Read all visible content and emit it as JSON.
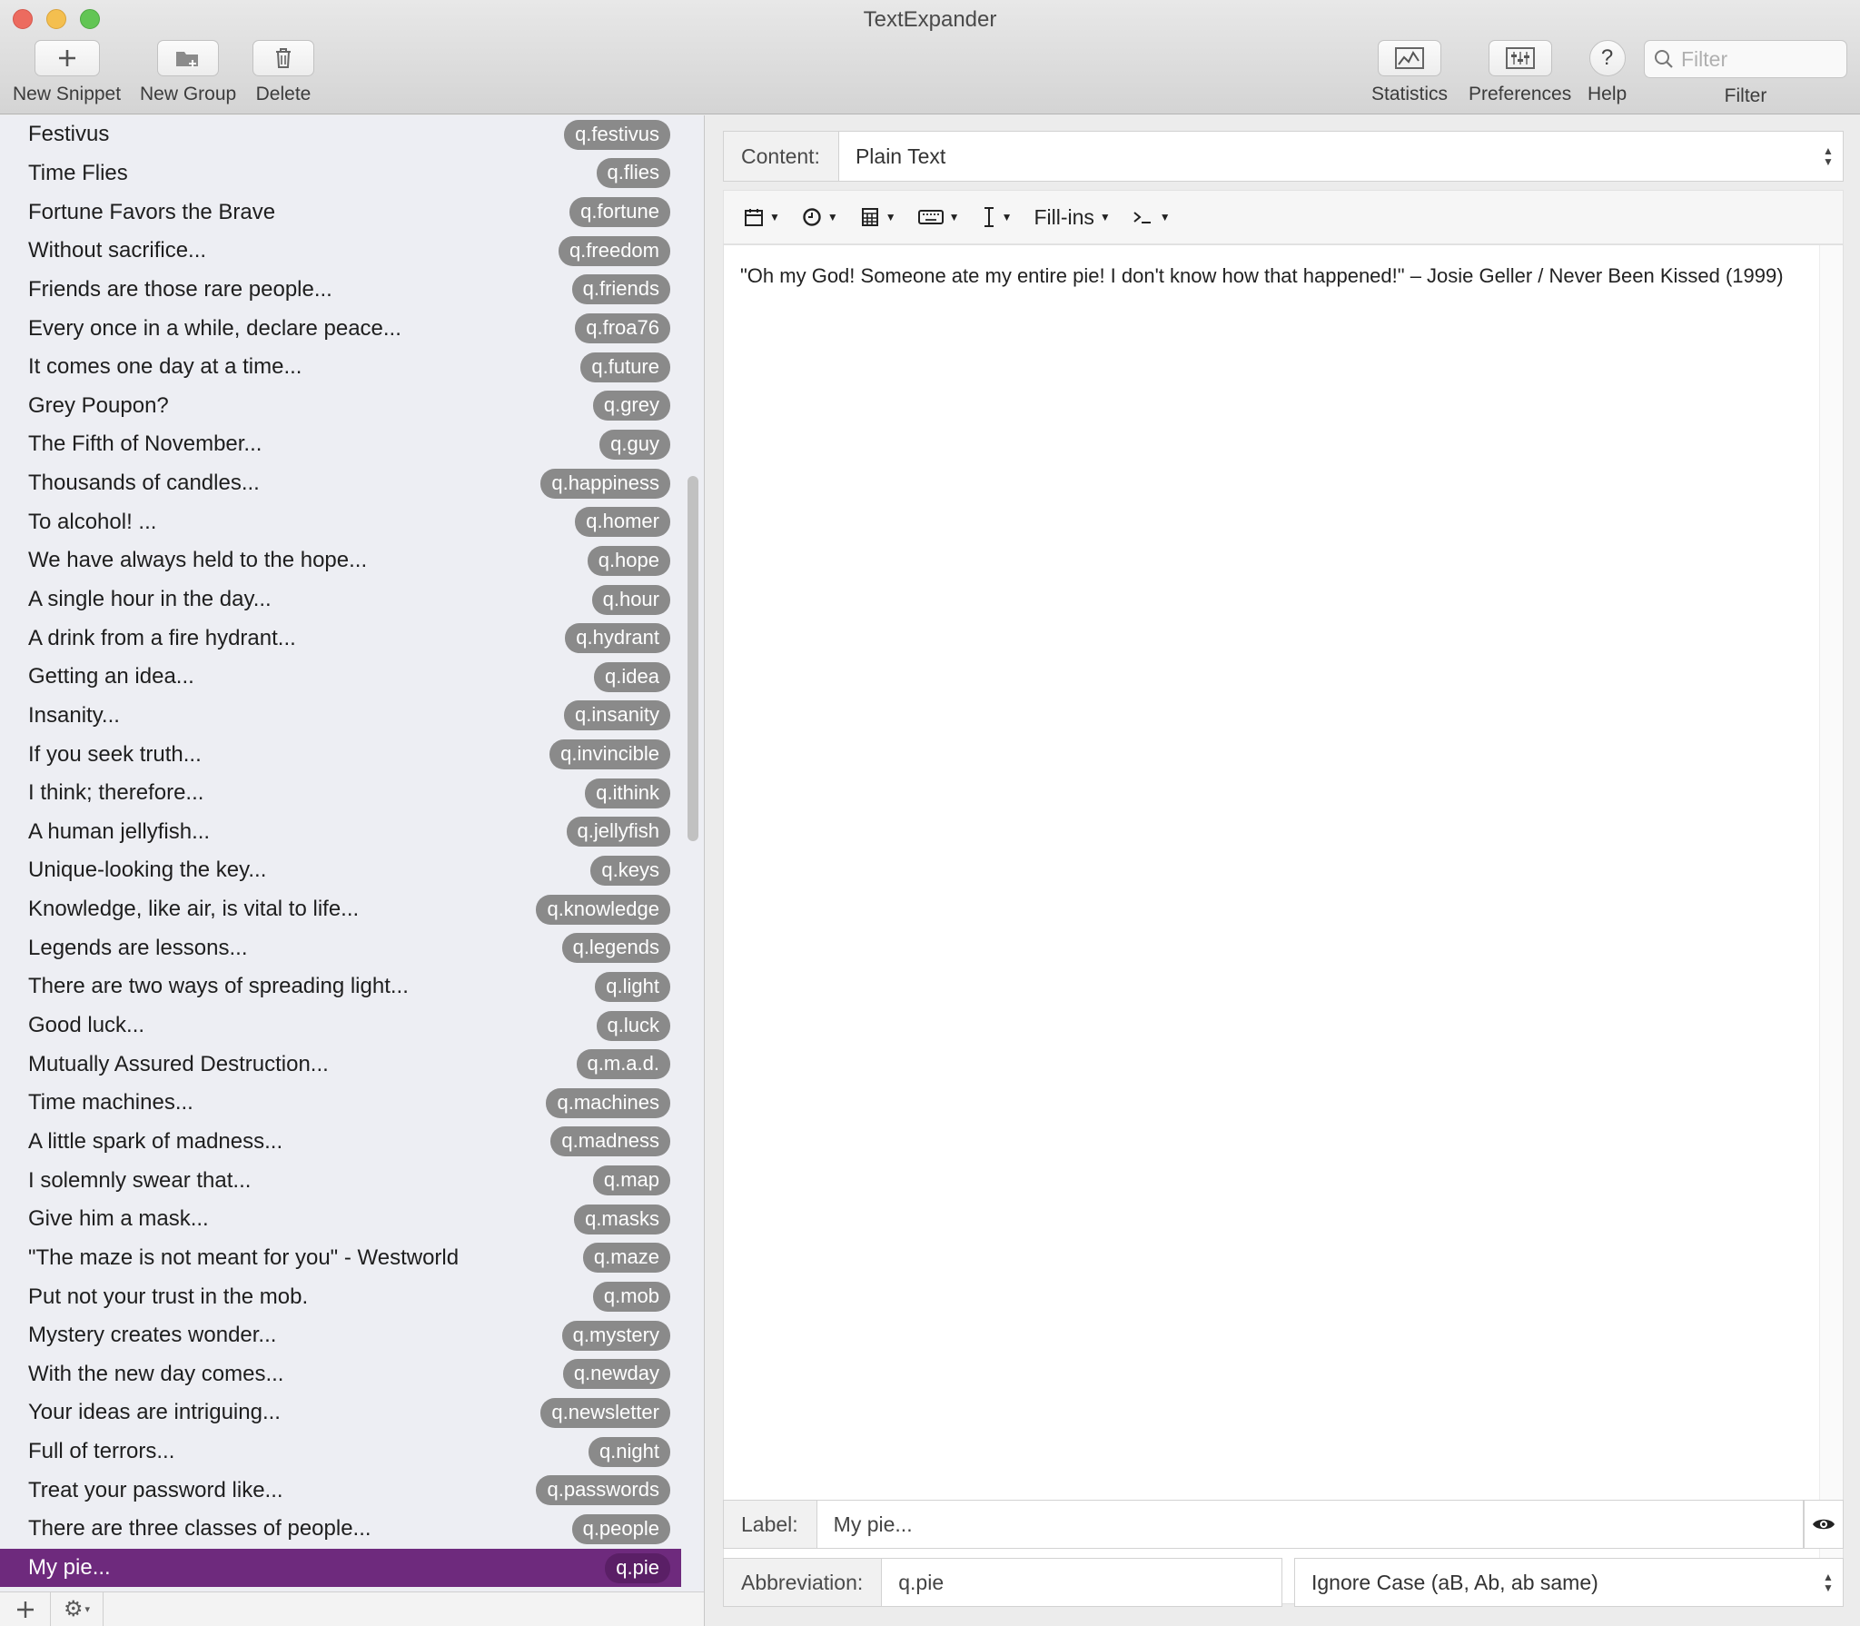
{
  "window": {
    "title": "TextExpander"
  },
  "toolbar": {
    "new_snippet": "New Snippet",
    "new_group": "New Group",
    "delete": "Delete",
    "statistics": "Statistics",
    "preferences": "Preferences",
    "help": "Help",
    "filter_placeholder": "Filter",
    "filter_label": "Filter"
  },
  "snippets": [
    {
      "name": "Festivus",
      "abbr": "q.festivus"
    },
    {
      "name": "Time Flies",
      "abbr": "q.flies"
    },
    {
      "name": "Fortune Favors the Brave",
      "abbr": "q.fortune"
    },
    {
      "name": "Without sacrifice...",
      "abbr": "q.freedom"
    },
    {
      "name": "Friends are those rare people...",
      "abbr": "q.friends"
    },
    {
      "name": "Every once in a while, declare peace...",
      "abbr": "q.froa76"
    },
    {
      "name": "It comes one day at a time...",
      "abbr": "q.future"
    },
    {
      "name": "Grey Poupon?",
      "abbr": "q.grey"
    },
    {
      "name": "The Fifth of November...",
      "abbr": "q.guy"
    },
    {
      "name": "Thousands of candles...",
      "abbr": "q.happiness"
    },
    {
      "name": "To alcohol! ...",
      "abbr": "q.homer"
    },
    {
      "name": "We have always held to the hope...",
      "abbr": "q.hope"
    },
    {
      "name": "A single hour in the day...",
      "abbr": "q.hour"
    },
    {
      "name": "A drink from a fire hydrant...",
      "abbr": "q.hydrant"
    },
    {
      "name": "Getting an idea...",
      "abbr": "q.idea"
    },
    {
      "name": "Insanity...",
      "abbr": "q.insanity"
    },
    {
      "name": "If you seek truth...",
      "abbr": "q.invincible"
    },
    {
      "name": "I think; therefore...",
      "abbr": "q.ithink"
    },
    {
      "name": "A human jellyfish...",
      "abbr": "q.jellyfish"
    },
    {
      "name": "Unique-looking the key...",
      "abbr": "q.keys"
    },
    {
      "name": "Knowledge, like air, is vital to life...",
      "abbr": "q.knowledge"
    },
    {
      "name": "Legends are lessons...",
      "abbr": "q.legends"
    },
    {
      "name": "There are two ways of spreading light...",
      "abbr": "q.light"
    },
    {
      "name": "Good luck...",
      "abbr": "q.luck"
    },
    {
      "name": "Mutually Assured Destruction...",
      "abbr": "q.m.a.d."
    },
    {
      "name": "Time machines...",
      "abbr": "q.machines"
    },
    {
      "name": "A little spark of madness...",
      "abbr": "q.madness"
    },
    {
      "name": "I solemnly swear that...",
      "abbr": "q.map"
    },
    {
      "name": "Give him a mask...",
      "abbr": "q.masks"
    },
    {
      "name": "\"The maze is not meant for you\" - Westworld",
      "abbr": "q.maze"
    },
    {
      "name": "Put not your trust in the mob.",
      "abbr": "q.mob"
    },
    {
      "name": "Mystery creates wonder...",
      "abbr": "q.mystery"
    },
    {
      "name": "With the new day comes...",
      "abbr": "q.newday"
    },
    {
      "name": "Your ideas are intriguing...",
      "abbr": "q.newsletter"
    },
    {
      "name": "Full of terrors...",
      "abbr": "q.night"
    },
    {
      "name": "Treat your password like...",
      "abbr": "q.passwords"
    },
    {
      "name": "There are three classes of people...",
      "abbr": "q.people"
    },
    {
      "name": "My pie...",
      "abbr": "q.pie",
      "selected": true
    }
  ],
  "editor": {
    "content_label": "Content:",
    "content_type": "Plain Text",
    "fill_ins": "Fill-ins",
    "text": "\"Oh my God! Someone ate my entire pie! I don't know how that happened!\" – Josie Geller / Never Been Kissed (1999)",
    "label_label": "Label:",
    "label_value": "My pie...",
    "abbreviation_label": "Abbreviation:",
    "abbreviation_value": "q.pie",
    "case_option": "Ignore Case (aB, Ab, ab same)"
  },
  "colors": {
    "selection": "#6e2a7d",
    "badge": "#8a8a8a"
  }
}
